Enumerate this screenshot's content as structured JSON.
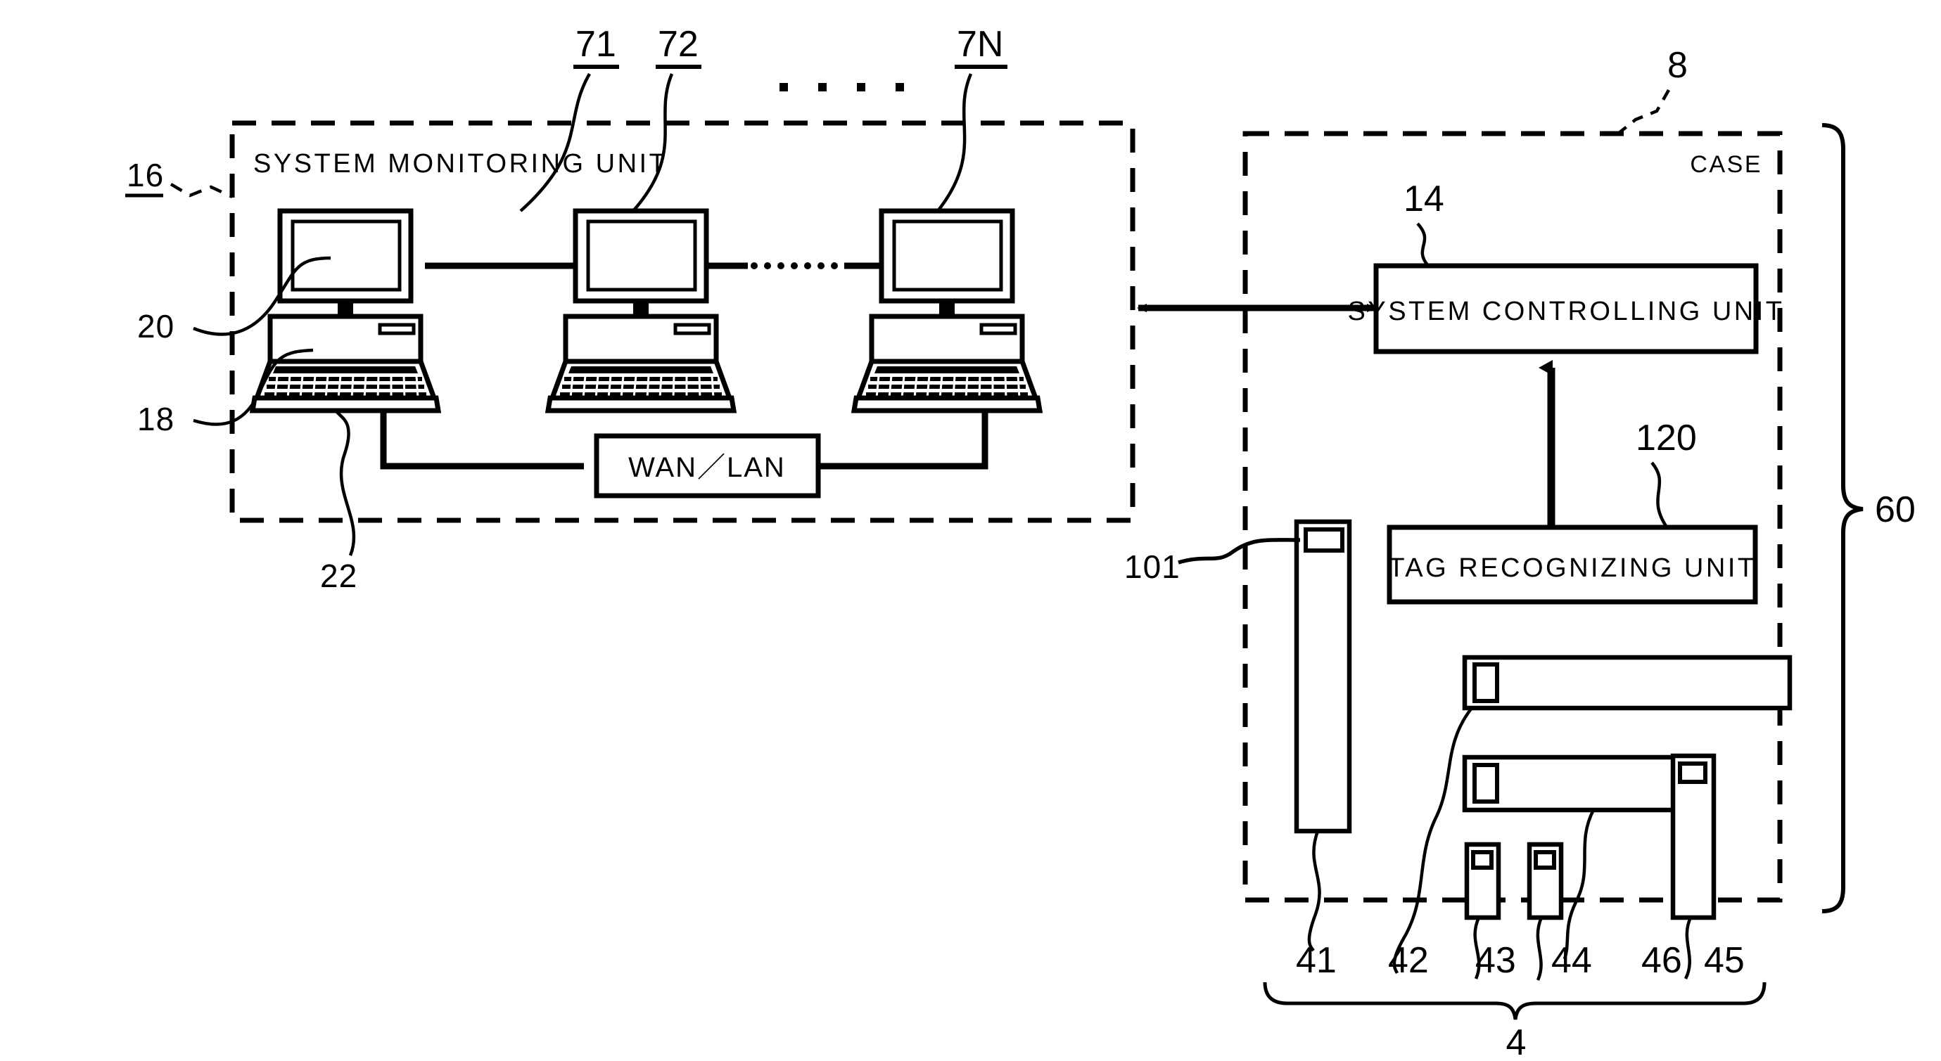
{
  "figure": {
    "type": "patent-block-diagram",
    "background": "#ffffff",
    "line_color": "#000000"
  },
  "left_panel": {
    "name": "system-monitoring-unit-panel",
    "title": "SYSTEM MONITORING UNIT",
    "ref": "16",
    "border": "dashed",
    "terminals": [
      {
        "ref": "71",
        "label": "71"
      },
      {
        "ref": "72",
        "label": "72"
      },
      {
        "ref": "7N",
        "label": "7N"
      }
    ],
    "ellipsis": "· · · ·",
    "parts": [
      {
        "ref": "20",
        "name": "display-monitor"
      },
      {
        "ref": "18",
        "name": "keyboard"
      },
      {
        "ref": "22",
        "name": "network-cable"
      }
    ],
    "network_box": {
      "label": "WAN／LAN",
      "name": "wan-lan-box"
    }
  },
  "right_panel": {
    "name": "case-panel",
    "label": "CASE",
    "ref": "8",
    "border": "dashed",
    "blocks": [
      {
        "ref": "14",
        "label": "SYSTEM CONTROLLING UNIT",
        "name": "system-controlling-unit"
      },
      {
        "ref": "120",
        "label": "TAG RECOGNIZING UNIT",
        "name": "tag-recognizing-unit"
      }
    ],
    "equipment_ref": "101",
    "equipment_group_ref": "4",
    "equipment_items": [
      {
        "ref": "41",
        "name": "equipment-41"
      },
      {
        "ref": "42",
        "name": "equipment-42"
      },
      {
        "ref": "43",
        "name": "equipment-43"
      },
      {
        "ref": "44",
        "name": "equipment-44"
      },
      {
        "ref": "46",
        "name": "equipment-46"
      },
      {
        "ref": "45",
        "name": "equipment-45"
      }
    ]
  },
  "system_brace": {
    "ref": "60",
    "name": "whole-system-brace"
  }
}
